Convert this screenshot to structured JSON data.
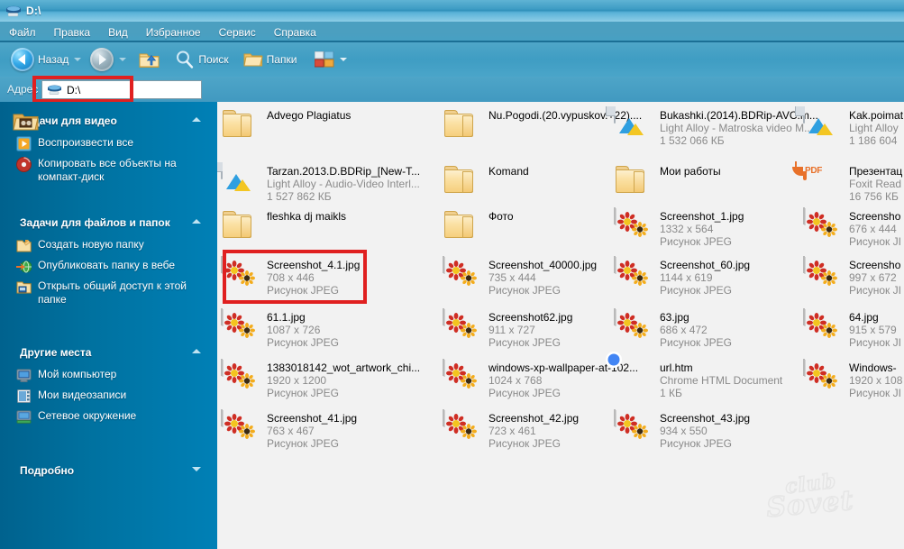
{
  "window": {
    "title": "D:\\",
    "title_icon": "drive-icon"
  },
  "menu": {
    "items": [
      {
        "label": "Файл"
      },
      {
        "label": "Правка"
      },
      {
        "label": "Вид"
      },
      {
        "label": "Избранное"
      },
      {
        "label": "Сервис"
      },
      {
        "label": "Справка"
      }
    ]
  },
  "toolbar": {
    "back_label": "Назад",
    "back_icon": "back-arrow-icon",
    "forward_icon": "forward-arrow-icon",
    "up_icon": "up-folder-icon",
    "search_label": "Поиск",
    "search_icon": "search-icon",
    "folders_label": "Папки",
    "folders_icon": "folders-icon",
    "views_icon": "views-icon"
  },
  "address": {
    "label": "Адрес",
    "value": "D:\\",
    "icon": "drive-icon"
  },
  "sidebar": {
    "panels": [
      {
        "title": "Задачи для видео",
        "chevron": "chevron-up-icon",
        "items": [
          {
            "label": "Воспроизвести все",
            "icon": "play-icon"
          },
          {
            "label": "Копировать все объекты на компакт-диск",
            "icon": "burn-cd-icon"
          }
        ]
      },
      {
        "title": "Задачи для файлов и папок",
        "chevron": "chevron-up-icon",
        "items": [
          {
            "label": "Создать новую папку",
            "icon": "new-folder-icon"
          },
          {
            "label": "Опубликовать папку в вебе",
            "icon": "publish-web-icon"
          },
          {
            "label": "Открыть общий доступ к этой папке",
            "icon": "share-folder-icon"
          }
        ]
      },
      {
        "title": "Другие места",
        "chevron": "chevron-up-icon",
        "items": [
          {
            "label": "Мой компьютер",
            "icon": "my-computer-icon"
          },
          {
            "label": "Мои видеозаписи",
            "icon": "my-videos-icon"
          },
          {
            "label": "Сетевое окружение",
            "icon": "network-icon"
          }
        ]
      },
      {
        "title": "Подробно",
        "chevron": "chevron-down-icon",
        "items": []
      }
    ]
  },
  "colors": {
    "annotation_red": "#e02020",
    "sidebar_blue": "#00719f",
    "chrome_blue": "#4aa5c9",
    "content_bg": "#f2f2f2"
  },
  "files": {
    "columns": [
      {
        "items": [
          {
            "name": "Advego Plagiatus",
            "line2": "",
            "line3": "",
            "icon": "folder-icon"
          },
          {
            "name": "Tarzan.2013.D.BDRip_[New-T...",
            "line2": "Light Alloy - Audio-Video Interl...",
            "line3": "1 527 862 КБ",
            "icon": "light-alloy-icon"
          },
          {
            "name": "fleshka dj maikls",
            "line2": "",
            "line3": "",
            "icon": "folder-icon"
          },
          {
            "name": "Screenshot_4.1.jpg",
            "line2": "708 x 446",
            "line3": "Рисунок JPEG",
            "icon": "jpeg-thumbnail-icon",
            "highlighted": true
          },
          {
            "name": "61.1.jpg",
            "line2": "1087 x 726",
            "line3": "Рисунок JPEG",
            "icon": "jpeg-thumbnail-icon"
          },
          {
            "name": "1383018142_wot_artwork_chi...",
            "line2": "1920 x 1200",
            "line3": "Рисунок JPEG",
            "icon": "jpeg-thumbnail-icon"
          },
          {
            "name": "Screenshot_41.jpg",
            "line2": "763 x 467",
            "line3": "Рисунок JPEG",
            "icon": "jpeg-thumbnail-icon"
          }
        ]
      },
      {
        "items": [
          {
            "name": "Nu.Pogodi.(20.vypuskov.+22)....",
            "line2": "",
            "line3": "",
            "icon": "folder-icon"
          },
          {
            "name": "Komand",
            "line2": "",
            "line3": "",
            "icon": "folder-icon"
          },
          {
            "name": "Фото",
            "line2": "",
            "line3": "",
            "icon": "folder-icon"
          },
          {
            "name": "Screenshot_40000.jpg",
            "line2": "735 x 444",
            "line3": "Рисунок JPEG",
            "icon": "jpeg-thumbnail-icon"
          },
          {
            "name": "Screenshot62.jpg",
            "line2": "911 x 727",
            "line3": "Рисунок JPEG",
            "icon": "jpeg-thumbnail-icon"
          },
          {
            "name": "windows-xp-wallpaper-at-102...",
            "line2": "1024 x 768",
            "line3": "Рисунок JPEG",
            "icon": "jpeg-thumbnail-icon"
          },
          {
            "name": "Screenshot_42.jpg",
            "line2": "723 x 461",
            "line3": "Рисунок JPEG",
            "icon": "jpeg-thumbnail-icon"
          }
        ]
      },
      {
        "items": [
          {
            "name": "Bukashki.(2014).BDRip-AVC.m...",
            "line2": "Light Alloy - Matroska video M...",
            "line3": "1 532 066 КБ",
            "icon": "light-alloy-icon"
          },
          {
            "name": "Мои работы",
            "line2": "",
            "line3": "",
            "icon": "folder-icon"
          },
          {
            "name": "Screenshot_1.jpg",
            "line2": "1332 x 564",
            "line3": "Рисунок JPEG",
            "icon": "jpeg-thumbnail-icon"
          },
          {
            "name": "Screenshot_60.jpg",
            "line2": "1144 x 619",
            "line3": "Рисунок JPEG",
            "icon": "jpeg-thumbnail-icon"
          },
          {
            "name": "63.jpg",
            "line2": "686 x 472",
            "line3": "Рисунок JPEG",
            "icon": "jpeg-thumbnail-icon"
          },
          {
            "name": "url.htm",
            "line2": "Chrome HTML Document",
            "line3": "1 КБ",
            "icon": "chrome-icon"
          },
          {
            "name": "Screenshot_43.jpg",
            "line2": "934 x 550",
            "line3": "Рисунок JPEG",
            "icon": "jpeg-thumbnail-icon"
          }
        ]
      },
      {
        "items": [
          {
            "name": "Kak.poimat",
            "line2": "Light Alloy",
            "line3": "1 186 604",
            "icon": "light-alloy-icon"
          },
          {
            "name": "Презентац",
            "line2": "Foxit Read",
            "line3": "16 756 КБ",
            "icon": "pdf-icon"
          },
          {
            "name": "Screensho",
            "line2": "676 x 444",
            "line3": "Рисунок JI",
            "icon": "jpeg-thumbnail-icon"
          },
          {
            "name": "Screensho",
            "line2": "997 x 672",
            "line3": "Рисунок JI",
            "icon": "jpeg-thumbnail-icon"
          },
          {
            "name": "64.jpg",
            "line2": "915 x 579",
            "line3": "Рисунок JI",
            "icon": "jpeg-thumbnail-icon"
          },
          {
            "name": "Windows-",
            "line2": "1920 x 108",
            "line3": "Рисунок JI",
            "icon": "jpeg-thumbnail-icon"
          }
        ]
      }
    ]
  },
  "watermark": {
    "line1": "club",
    "line2": "Sovet"
  }
}
